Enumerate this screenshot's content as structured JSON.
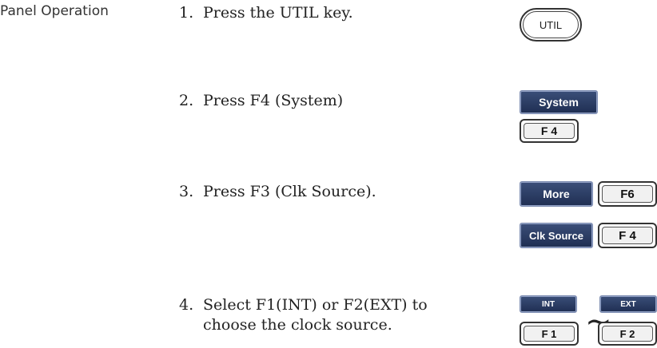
{
  "section": {
    "label": "Panel Operation"
  },
  "steps": [
    {
      "num": "1.",
      "text": "Press the UTIL key."
    },
    {
      "num": "2.",
      "text": "Press F4 (System)"
    },
    {
      "num": "3.",
      "text": "Press F3 (Clk Source)."
    },
    {
      "num": "4.",
      "text": "Select F1(INT) or F2(EXT) to",
      "text2": "choose the clock source."
    }
  ],
  "keys": {
    "util": "UTIL",
    "system": "System",
    "f4": "F 4",
    "more": "More",
    "f6": "F6",
    "clk_source": "Clk Source",
    "f4b": "F 4",
    "int": "INT",
    "ext": "EXT",
    "f1": "F 1",
    "f2": "F 2",
    "tilde": "∼"
  }
}
